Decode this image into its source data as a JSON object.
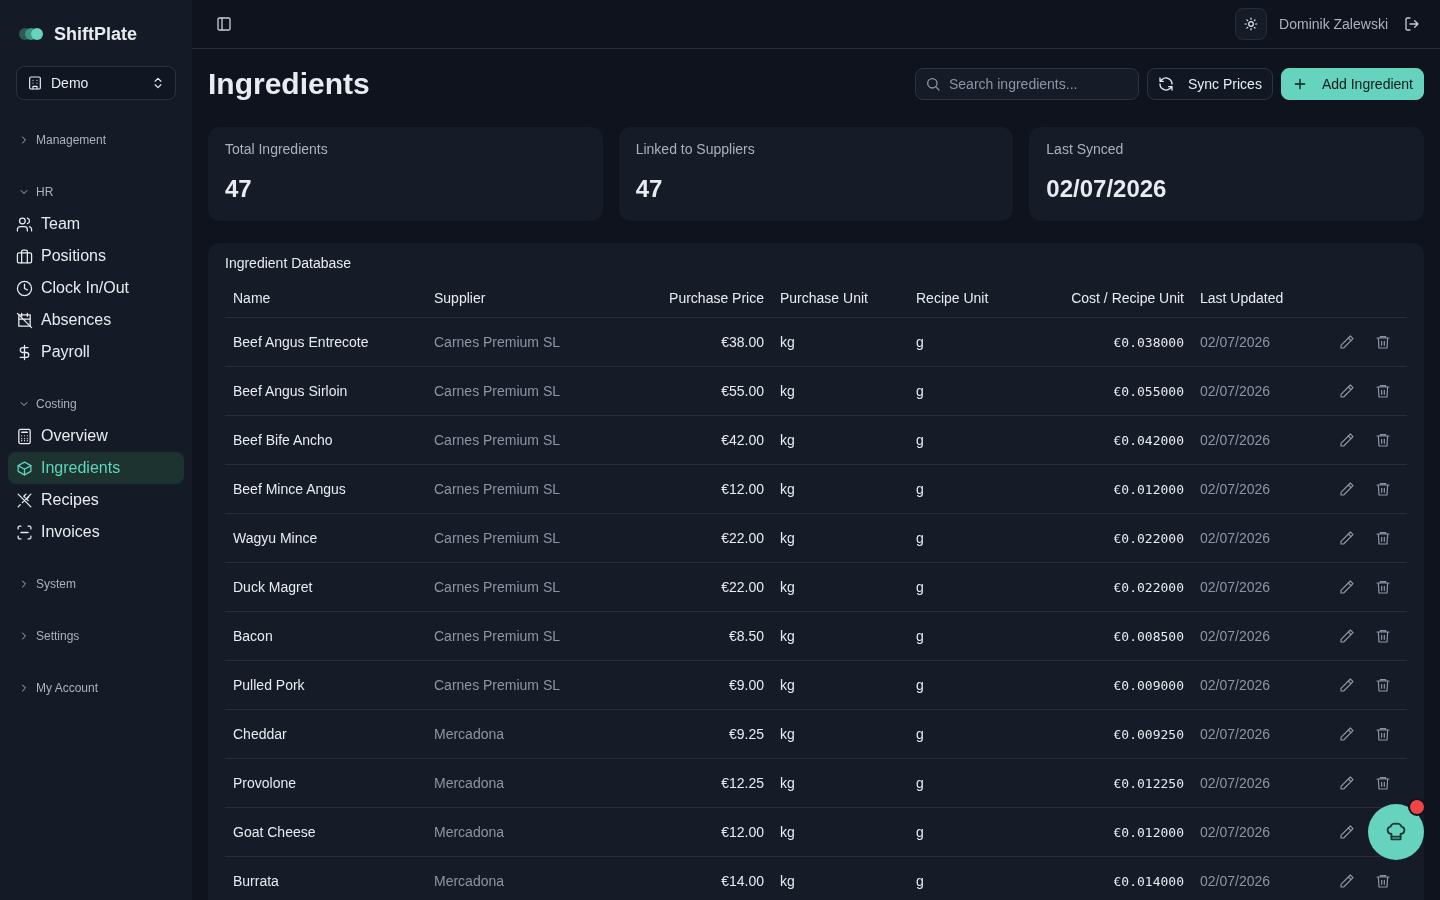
{
  "brand": {
    "name": "ShiftPlate"
  },
  "workspace": {
    "value": "Demo"
  },
  "nav": [
    {
      "label": "Management",
      "expanded": false
    },
    {
      "label": "HR",
      "expanded": true,
      "children": [
        {
          "label": "Team",
          "selected": false
        },
        {
          "label": "Positions",
          "selected": false
        },
        {
          "label": "Clock In/Out",
          "selected": false
        },
        {
          "label": "Absences",
          "selected": false
        },
        {
          "label": "Payroll",
          "selected": false
        }
      ]
    },
    {
      "label": "Costing",
      "expanded": true,
      "children": [
        {
          "label": "Overview",
          "selected": false
        },
        {
          "label": "Ingredients",
          "selected": true
        },
        {
          "label": "Recipes",
          "selected": false
        },
        {
          "label": "Invoices",
          "selected": false
        }
      ]
    },
    {
      "label": "System",
      "expanded": false
    },
    {
      "label": "Settings",
      "expanded": false
    },
    {
      "label": "My Account",
      "expanded": false
    }
  ],
  "header": {
    "user": "Dominik Zalewski"
  },
  "page": {
    "title": "Ingredients",
    "search_placeholder": "Search ingredients...",
    "buttons": [
      {
        "label": "Sync Prices",
        "kind": "secondary"
      },
      {
        "label": "Add Ingredient",
        "kind": "primary"
      }
    ]
  },
  "stats": [
    {
      "label": "Total Ingredients",
      "value": "47"
    },
    {
      "label": "Linked to Suppliers",
      "value": "47"
    },
    {
      "label": "Last Synced",
      "value": "02/07/2026"
    }
  ],
  "table": {
    "title": "Ingredient Database",
    "columns": [
      "Name",
      "Supplier",
      "Purchase Price",
      "Purchase Unit",
      "Recipe Unit",
      "Cost / Recipe Unit",
      "Last Updated"
    ],
    "rows": [
      {
        "cells": [
          "Beef Angus Entrecote",
          "Carnes Premium SL",
          "€38.00",
          "kg",
          "g",
          "€0.038000",
          "02/07/2026"
        ],
        "delete_visible": true
      },
      {
        "cells": [
          "Beef Angus Sirloin",
          "Carnes Premium SL",
          "€55.00",
          "kg",
          "g",
          "€0.055000",
          "02/07/2026"
        ],
        "delete_visible": true
      },
      {
        "cells": [
          "Beef Bife Ancho",
          "Carnes Premium SL",
          "€42.00",
          "kg",
          "g",
          "€0.042000",
          "02/07/2026"
        ],
        "delete_visible": true
      },
      {
        "cells": [
          "Beef Mince Angus",
          "Carnes Premium SL",
          "€12.00",
          "kg",
          "g",
          "€0.012000",
          "02/07/2026"
        ],
        "delete_visible": true
      },
      {
        "cells": [
          "Wagyu Mince",
          "Carnes Premium SL",
          "€22.00",
          "kg",
          "g",
          "€0.022000",
          "02/07/2026"
        ],
        "delete_visible": true
      },
      {
        "cells": [
          "Duck Magret",
          "Carnes Premium SL",
          "€22.00",
          "kg",
          "g",
          "€0.022000",
          "02/07/2026"
        ],
        "delete_visible": true
      },
      {
        "cells": [
          "Bacon",
          "Carnes Premium SL",
          "€8.50",
          "kg",
          "g",
          "€0.008500",
          "02/07/2026"
        ],
        "delete_visible": true
      },
      {
        "cells": [
          "Pulled Pork",
          "Carnes Premium SL",
          "€9.00",
          "kg",
          "g",
          "€0.009000",
          "02/07/2026"
        ],
        "delete_visible": true
      },
      {
        "cells": [
          "Cheddar",
          "Mercadona",
          "€9.25",
          "kg",
          "g",
          "€0.009250",
          "02/07/2026"
        ],
        "delete_visible": true
      },
      {
        "cells": [
          "Provolone",
          "Mercadona",
          "€12.25",
          "kg",
          "g",
          "€0.012250",
          "02/07/2026"
        ],
        "delete_visible": true
      },
      {
        "cells": [
          "Goat Cheese",
          "Mercadona",
          "€12.00",
          "kg",
          "g",
          "€0.012000",
          "02/07/2026"
        ],
        "delete_visible": false
      },
      {
        "cells": [
          "Burrata",
          "Mercadona",
          "€14.00",
          "kg",
          "g",
          "€0.014000",
          "02/07/2026"
        ],
        "delete_visible": true
      }
    ]
  },
  "assistant": {
    "notification": true
  }
}
